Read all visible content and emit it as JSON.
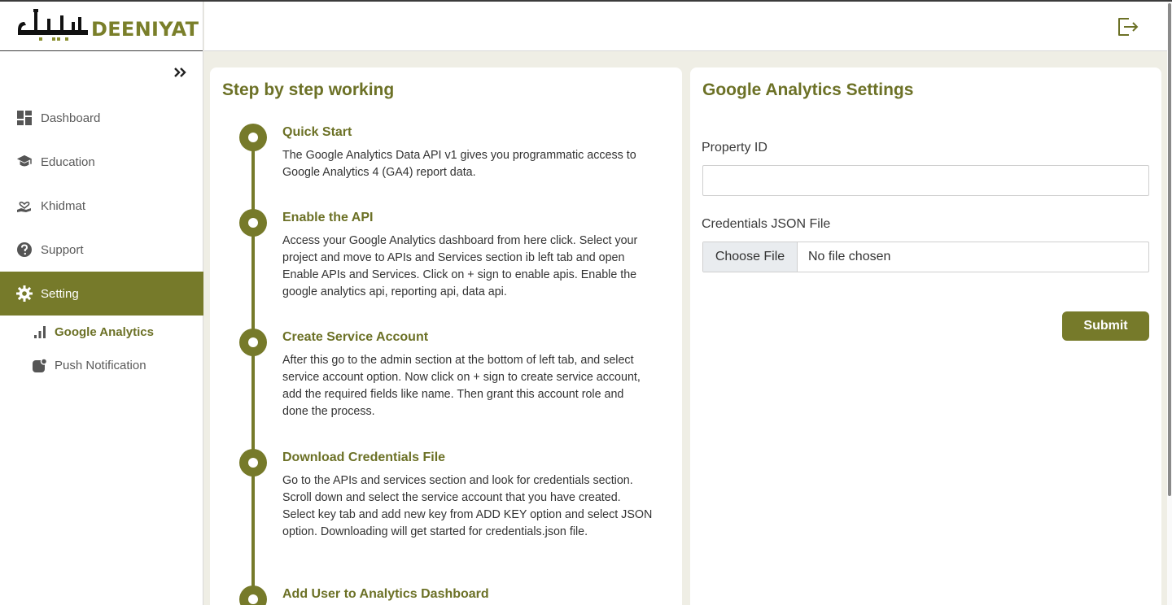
{
  "brand": {
    "name": "DEENIYAT",
    "color": "#767a2a"
  },
  "sidebar": {
    "collapse_icon": "double-chevron-right-icon",
    "items": [
      {
        "label": "Dashboard",
        "icon": "dashboard-icon"
      },
      {
        "label": "Education",
        "icon": "graduation-icon"
      },
      {
        "label": "Khidmat",
        "icon": "hand-heart-icon"
      },
      {
        "label": "Support",
        "icon": "question-icon"
      },
      {
        "label": "Setting",
        "icon": "gear-icon",
        "active": true
      }
    ],
    "subitems": [
      {
        "label": "Google Analytics",
        "icon": "bar-chart-icon",
        "active": true
      },
      {
        "label": "Push Notification",
        "icon": "notification-icon"
      }
    ]
  },
  "topbar": {
    "logout_icon": "logout-icon"
  },
  "steps_card": {
    "title": "Step by step working",
    "steps": [
      {
        "title": "Quick Start",
        "text": "The Google Analytics Data API v1 gives you programmatic access to Google Analytics 4 (GA4) report data."
      },
      {
        "title": "Enable the API",
        "text": "Access your Google Analytics dashboard from here click. Select your project and move to APIs and Services section ib left tab and open Enable APIs and Services. Click on + sign to enable apis. Enable the google analytics api, reporting api, data api."
      },
      {
        "title": "Create Service Account",
        "text": "After this go to the admin section at the bottom of left tab, and select service account option. Now click on + sign to create service account, add the required fields like name. Then grant this account role and done the process."
      },
      {
        "title": "Download Credentials File",
        "text": "Go to the APIs and services section and look for credentials section. Scroll down and select the service account that you have created. Select key tab and add new key from ADD KEY option and select JSON option. Downloading will get started for credentials.json file."
      },
      {
        "title": "Add User to Analytics Dashboard",
        "text": ""
      }
    ]
  },
  "settings_card": {
    "title": "Google Analytics Settings",
    "property_id_label": "Property ID",
    "property_id_value": "",
    "credentials_label": "Credentials JSON File",
    "choose_file_label": "Choose File",
    "file_status": "No file chosen",
    "submit_label": "Submit"
  }
}
